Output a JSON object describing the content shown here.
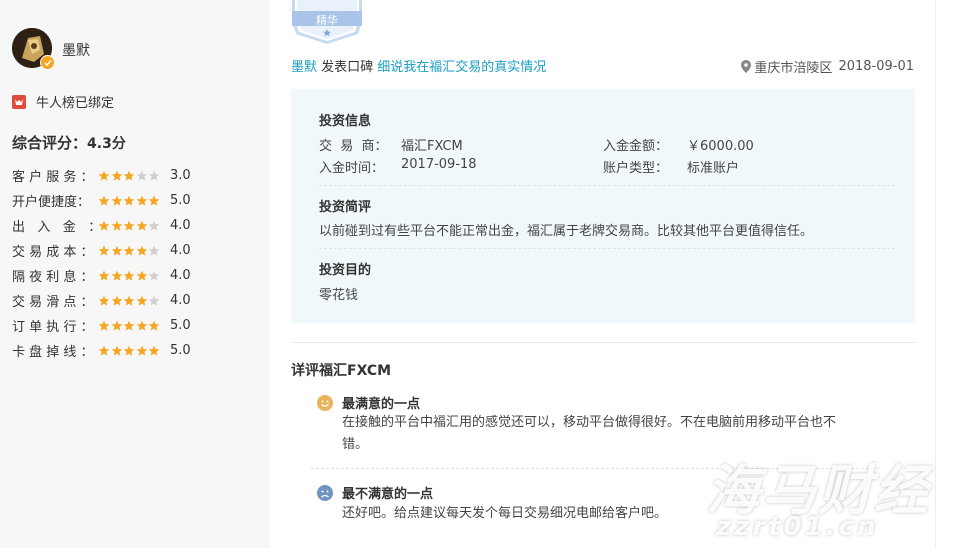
{
  "user": {
    "name": "墨默",
    "bound_text": "牛人榜已绑定"
  },
  "summary": {
    "label": "综合评分：",
    "value": "4.3分"
  },
  "ratings": [
    {
      "label": "客 户 服 务 ：",
      "stars": 3,
      "value": "3.0"
    },
    {
      "label": "开户便捷度：",
      "stars": 5,
      "value": "5.0"
    },
    {
      "label": "出   入   金   ：",
      "stars": 4,
      "value": "4.0"
    },
    {
      "label": "交 易 成 本 ：",
      "stars": 4,
      "value": "4.0"
    },
    {
      "label": "隔 夜 利 息 ：",
      "stars": 4,
      "value": "4.0"
    },
    {
      "label": "交 易 滑 点 ：",
      "stars": 4,
      "value": "4.0"
    },
    {
      "label": "订 单 执 行 ：",
      "stars": 5,
      "value": "5.0"
    },
    {
      "label": "卡 盘 掉 线 ：",
      "stars": 5,
      "value": "5.0"
    }
  ],
  "review": {
    "badge": "精华",
    "author": "墨默",
    "action": " 发表口碑 ",
    "title": "细说我在福汇交易的真实情况",
    "location": "重庆市涪陵区",
    "date": "2018-09-01"
  },
  "investment": {
    "title": "投资信息",
    "broker_label": "交  易  商：",
    "broker_value": "福汇FXCM",
    "amount_label": "入金金额：",
    "amount_value": "￥6000.00",
    "time_label": "入金时间：",
    "time_value": "2017-09-18",
    "account_label": "账户类型：",
    "account_value": "标准账户"
  },
  "brief": {
    "title": "投资简评",
    "text": "以前碰到过有些平台不能正常出金，福汇属于老牌交易商。比较其他平台更值得信任。"
  },
  "purpose": {
    "title": "投资目的",
    "text": "零花钱"
  },
  "detail": {
    "title": "详评福汇FXCM",
    "best_title": "最满意的一点",
    "best_line1": "在接触的平台中福汇用的感觉还可以，移动平台做得很好。不在电脑前用移动平台也不",
    "best_line2": "错。",
    "worst_title": "最不满意的一点",
    "worst_text": "还好吧。给点建议每天发个每日交易细况电邮给客户吧。"
  },
  "watermark": {
    "line1": "海马财经",
    "line2": "zzrt01.cn"
  },
  "colors": {
    "star_on": "#f5a623",
    "star_off": "#d0d0d0",
    "link": "#1a9ec2",
    "panel_bg": "#f1f8fc"
  }
}
